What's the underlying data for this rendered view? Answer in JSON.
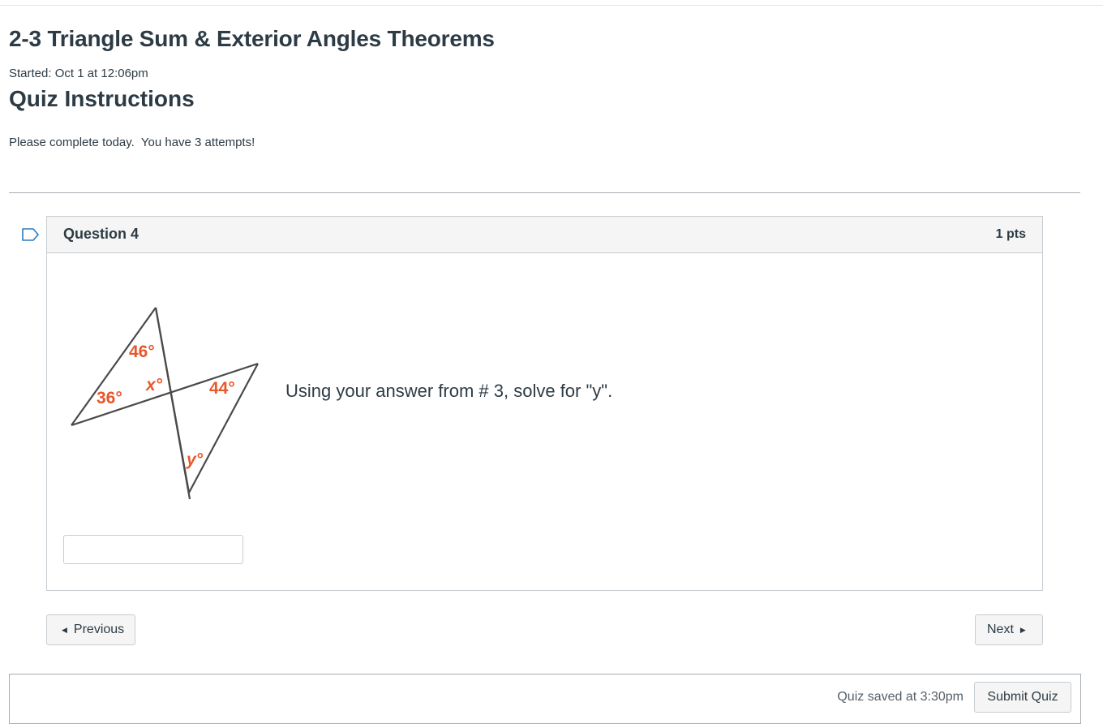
{
  "quiz": {
    "title": "2-3 Triangle Sum & Exterior Angles Theorems",
    "started": "Started: Oct 1 at 12:06pm",
    "instructions_heading": "Quiz Instructions",
    "instructions_body": "Please complete today.  You have 3 attempts!"
  },
  "question": {
    "name": "Question 4",
    "points": "1 pts",
    "text": "Using your answer from # 3, solve for \"y\".",
    "flag_icon": "bookmark-flag-icon",
    "answer_value": "",
    "diagram": {
      "angle_top": "46°",
      "angle_left": "36°",
      "angle_x": "x°",
      "angle_right": "44°",
      "angle_y": "y°",
      "label_color": "#e8572a",
      "line_color": "#4a4a4a"
    }
  },
  "navigation": {
    "previous_label": "Previous",
    "previous_icon": "caret-left-icon",
    "next_label": "Next",
    "next_icon": "caret-right-icon"
  },
  "footer": {
    "saved_text": "Quiz saved at 3:30pm",
    "submit_label": "Submit Quiz"
  }
}
